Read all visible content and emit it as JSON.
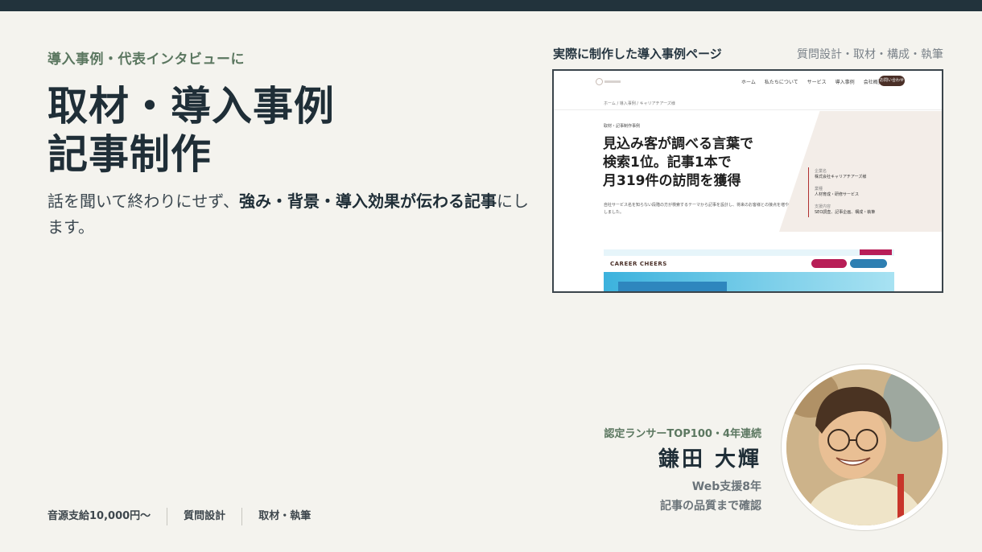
{
  "hero": {
    "eyebrow": "導入事例・代表インタビューに",
    "title_line1": "取材・導入事例",
    "title_line2": "記事制作",
    "lead_plain": "話を聞いて終わりにせず、",
    "lead_bold": "強み・背景・導入効果が伝わる記事",
    "lead_end": "にします。"
  },
  "case": {
    "title": "実際に制作した導入事例ページ",
    "meta": "質問設計・取材・構成・執筆"
  },
  "screenshot": {
    "nav": [
      "ホーム",
      "私たちについて",
      "サービス",
      "導入事例",
      "会社概要"
    ],
    "contact": "お問い合わせ",
    "breadcrumb": "ホーム / 導入事例 / キャリアチアーズ様",
    "kicker": "取材・記事制作事例",
    "article_title_1": "見込み客が調べる言葉で",
    "article_title_2": "検索1位。記事1本で",
    "article_title_3": "月319件の訪問を獲得",
    "desc": "自社サービス名を知らない段階の方が検索するテーマから記事を設計し、将来のお客様との接点を増やしました。",
    "info": [
      {
        "label": "企業名",
        "value": "株式会社キャリアチアーズ様"
      },
      {
        "label": "業種",
        "value": "人材育成・研修サービス"
      },
      {
        "label": "支援内容",
        "value": "SEO調査、記事企画、構成・執筆"
      }
    ],
    "banner_logo": "CAREER CHEERS"
  },
  "profile": {
    "badge": "認定ランサーTOP100・4年連続",
    "name": "鎌田 大輝",
    "line1": "Web支援8年",
    "line2": "記事の品質まで確認"
  },
  "footer": {
    "item1": "音源支給10,000円〜",
    "item2": "質問設計",
    "item3": "取材・執筆"
  },
  "colors": {
    "background": "#f4f3ee",
    "topbar": "#22333c",
    "accent_green": "#5b7760",
    "text_dark": "#1f2e37"
  }
}
